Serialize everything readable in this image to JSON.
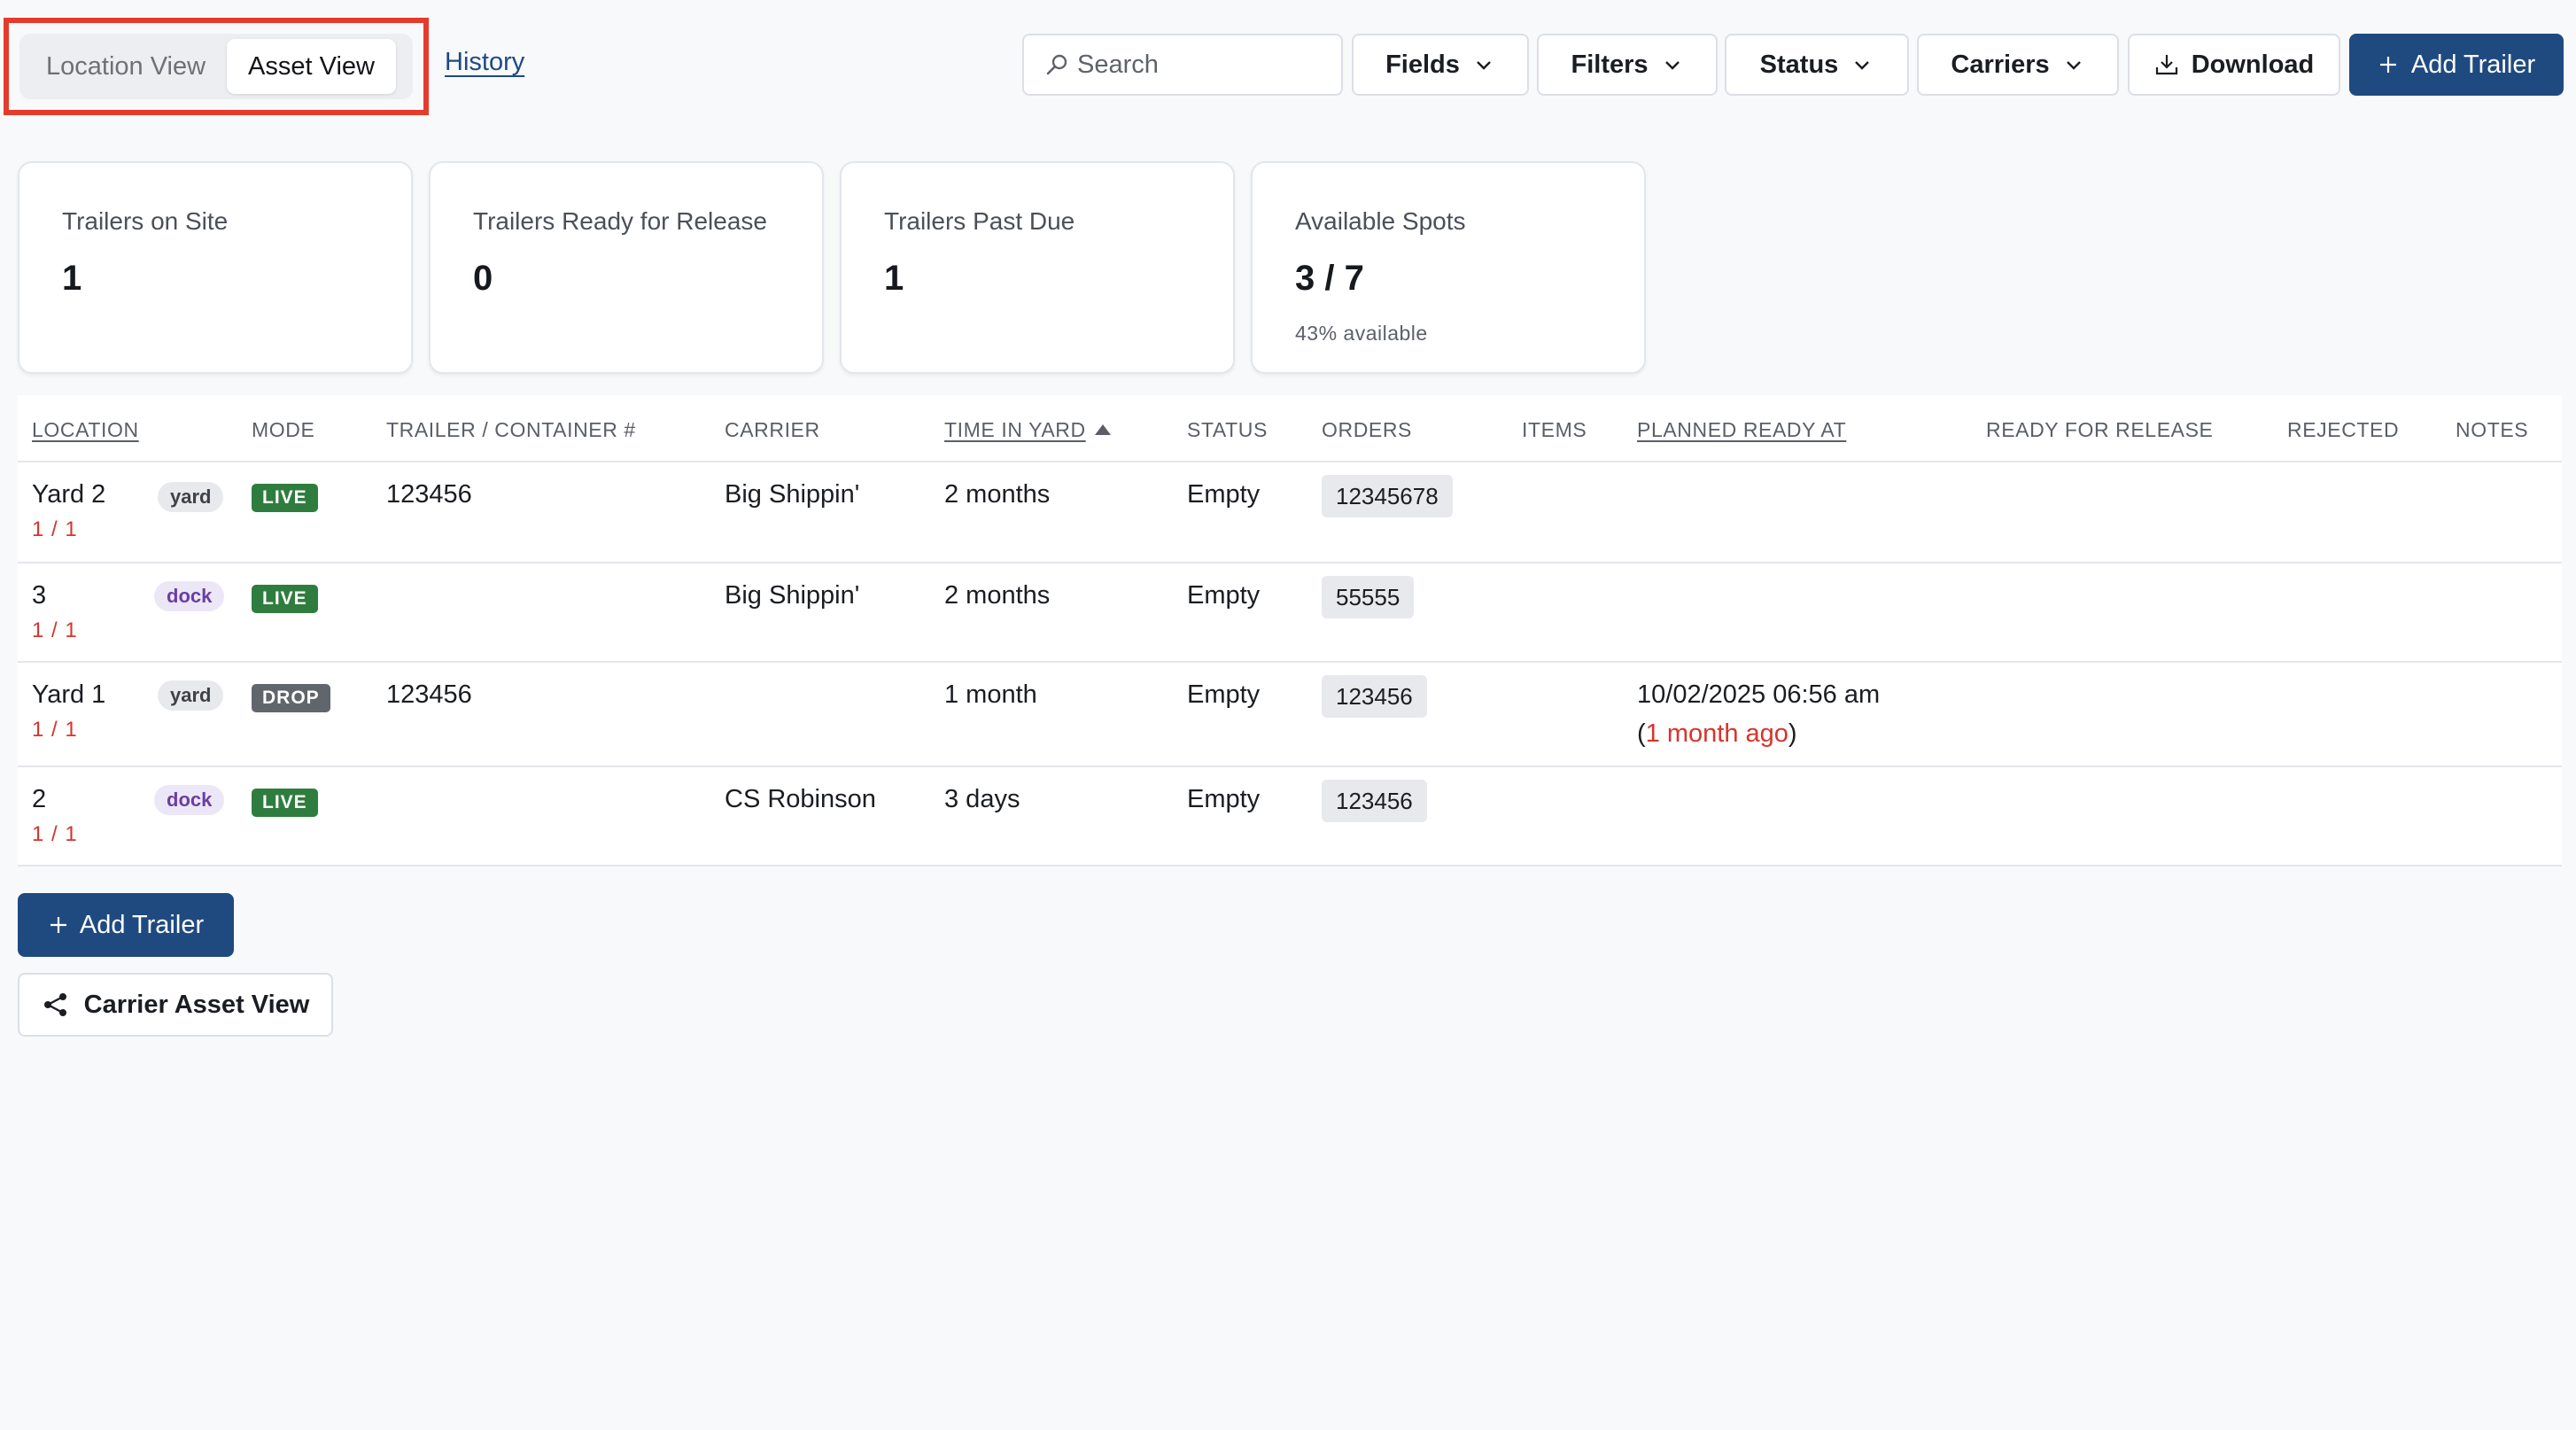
{
  "top_bar": {
    "view_toggle": {
      "location_view": "Location View",
      "asset_view": "Asset View"
    },
    "history_link": "History",
    "search": {
      "placeholder": "Search",
      "value": ""
    },
    "fields_label": "Fields",
    "filters_label": "Filters",
    "status_label": "Status",
    "carriers_label": "Carriers",
    "download_label": "Download",
    "add_trailer_label": "Add Trailer"
  },
  "stats": [
    {
      "title": "Trailers on Site",
      "value": "1"
    },
    {
      "title": "Trailers Ready for Release",
      "value": "0"
    },
    {
      "title": "Trailers Past Due",
      "value": "1"
    },
    {
      "title": "Available Spots",
      "value": "3 / 7",
      "sub": "43% available"
    }
  ],
  "table": {
    "headers": {
      "location": "LOCATION",
      "mode": "MODE",
      "trailer": "TRAILER / CONTAINER #",
      "carrier": "CARRIER",
      "time_in_yard": "TIME IN YARD",
      "status": "STATUS",
      "orders": "ORDERS",
      "items": "ITEMS",
      "planned_ready_at": "PLANNED READY AT",
      "ready_for_release": "READY FOR RELEASE",
      "rejected": "REJECTED",
      "notes": "NOTES"
    },
    "rows": [
      {
        "location": "Yard 2",
        "count": "1 / 1",
        "tag": "yard",
        "mode": "LIVE",
        "trailer": "123456",
        "carrier": "Big Shippin'",
        "time": "2 months",
        "status": "Empty",
        "order": "12345678",
        "planned": "",
        "planned_open": "",
        "planned_ago": "",
        "planned_close": ""
      },
      {
        "location": "3",
        "count": "1 / 1",
        "tag": "dock",
        "mode": "LIVE",
        "trailer": "",
        "carrier": "Big Shippin'",
        "time": "2 months",
        "status": "Empty",
        "order": "55555",
        "planned": "",
        "planned_open": "",
        "planned_ago": "",
        "planned_close": ""
      },
      {
        "location": "Yard 1",
        "count": "1 / 1",
        "tag": "yard",
        "mode": "DROP",
        "trailer": "123456",
        "carrier": "",
        "time": "1 month",
        "status": "Empty",
        "order": "123456",
        "planned": "10/02/2025 06:56 am",
        "planned_open": "(",
        "planned_ago": "1 month ago",
        "planned_close": ")"
      },
      {
        "location": "2",
        "count": "1 / 1",
        "tag": "dock",
        "mode": "LIVE",
        "trailer": "",
        "carrier": "CS Robinson",
        "time": "3 days",
        "status": "Empty",
        "order": "123456",
        "planned": "",
        "planned_open": "",
        "planned_ago": "",
        "planned_close": ""
      }
    ]
  },
  "bottom": {
    "add_trailer_label": "Add Trailer",
    "carrier_asset_view_label": "Carrier Asset View"
  },
  "icons": {
    "search": "search-icon",
    "chevron": "chevron-down-icon",
    "download": "download-icon",
    "plus": "plus-icon",
    "share": "share-icon"
  },
  "colors": {
    "primary": "#1f4a80",
    "highlight": "#e53b2c",
    "live": "#2f7d3e",
    "drop": "#61656c",
    "dock_tag": "#6a3ea6",
    "alert_text": "#d6342c"
  }
}
